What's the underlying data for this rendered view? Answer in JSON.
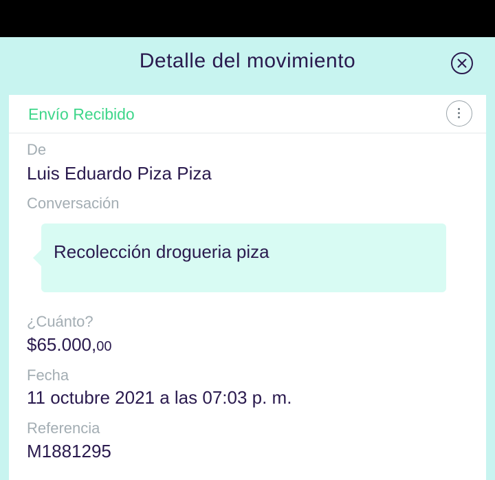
{
  "header": {
    "title": "Detalle del movimiento",
    "close_icon": "close-icon"
  },
  "card": {
    "type_label": "Envío Recibido",
    "type_color": "#3ed68a",
    "more_icon": "more-vertical-icon",
    "from": {
      "label": "De",
      "value": "Luis Eduardo Piza Piza"
    },
    "conversation": {
      "label": "Conversación",
      "message": "Recolección drogueria piza"
    },
    "amount": {
      "label": "¿Cuánto?",
      "main": "$65.000,",
      "cents": "00"
    },
    "date": {
      "label": "Fecha",
      "value": "11 octubre 2021 a las 07:03 p. m."
    },
    "reference": {
      "label": "Referencia",
      "value": "M1881295"
    }
  },
  "colors": {
    "background": "#c8f4f0",
    "text": "#2a1a4e",
    "muted": "#a3adb3",
    "bubble": "#d8fbf3"
  }
}
